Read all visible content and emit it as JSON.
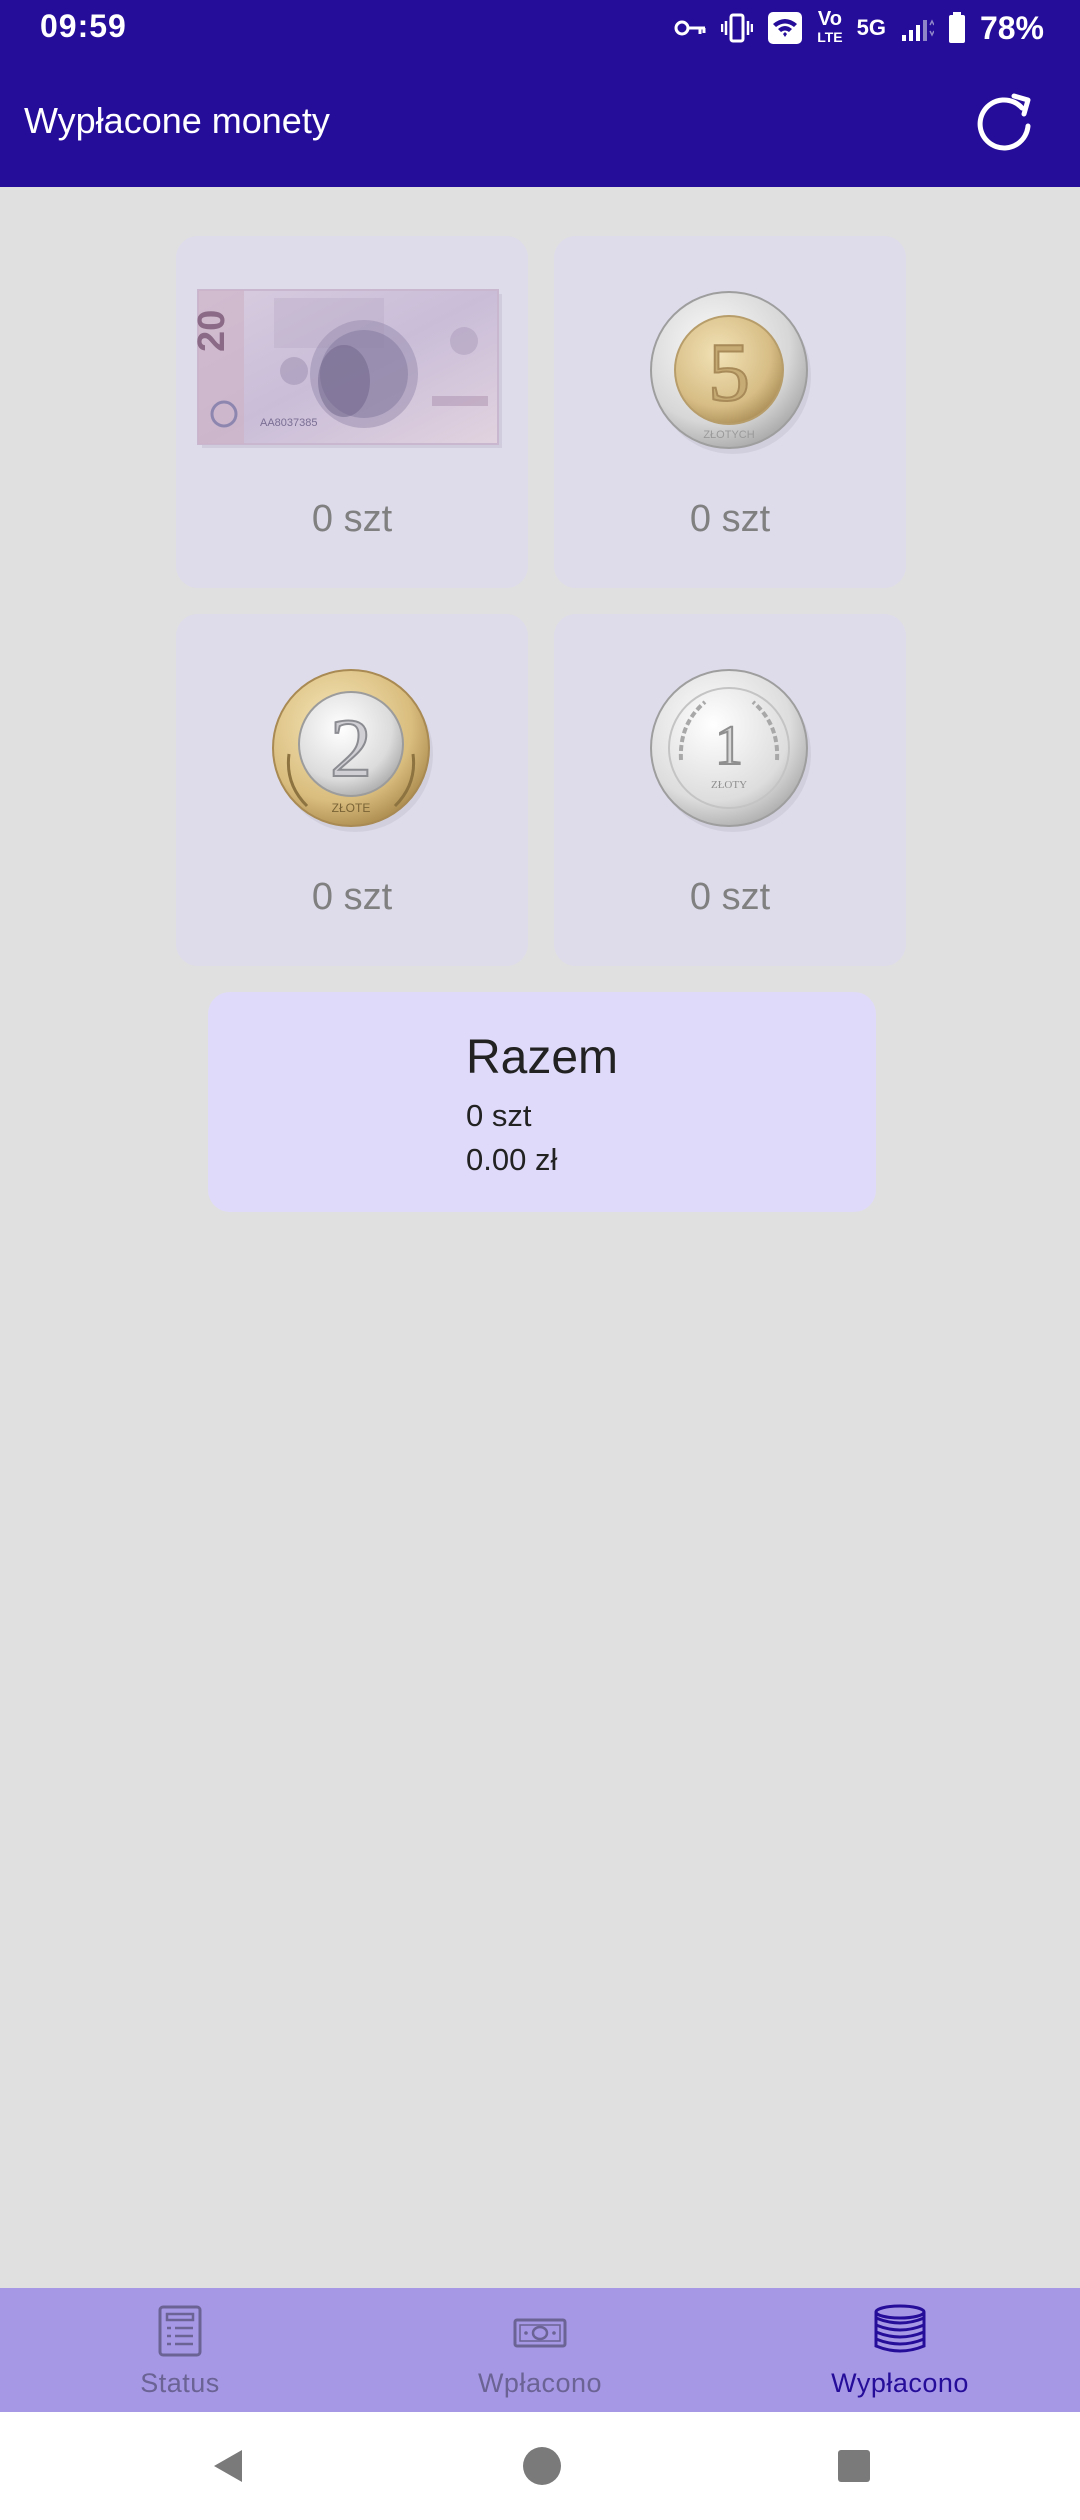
{
  "status_bar": {
    "time": "09:59",
    "network_label": "5G",
    "volte_label": "Vo",
    "lte_label": "LTE",
    "battery_percent": "78%",
    "icons": [
      "vpn-key-icon",
      "vibrate-icon",
      "wifi-icon",
      "volte-icon",
      "signal-icon",
      "battery-icon"
    ]
  },
  "app_bar": {
    "title": "Wypłacone monety",
    "action_icon": "refresh-icon"
  },
  "tiles": [
    {
      "denomination_icon": "banknote-20-icon",
      "count": "0 szt"
    },
    {
      "denomination_icon": "coin-5-icon",
      "count": "0 szt"
    },
    {
      "denomination_icon": "coin-2-icon",
      "count": "0 szt"
    },
    {
      "denomination_icon": "coin-1-icon",
      "count": "0 szt"
    }
  ],
  "summary": {
    "title": "Razem",
    "count": "0 szt",
    "amount": "0.00 zł"
  },
  "bottom_nav": {
    "items": [
      {
        "label": "Status",
        "icon": "status-list-icon",
        "active": false
      },
      {
        "label": "Wpłacono",
        "icon": "banknote-icon",
        "active": false
      },
      {
        "label": "Wypłacono",
        "icon": "coins-stack-icon",
        "active": true
      }
    ]
  },
  "colors": {
    "primary": "#250c99",
    "background": "#e0e0e0",
    "tile": "#dedbeb",
    "summary": "#e0dafa",
    "bottom_nav": "#a798e6"
  }
}
